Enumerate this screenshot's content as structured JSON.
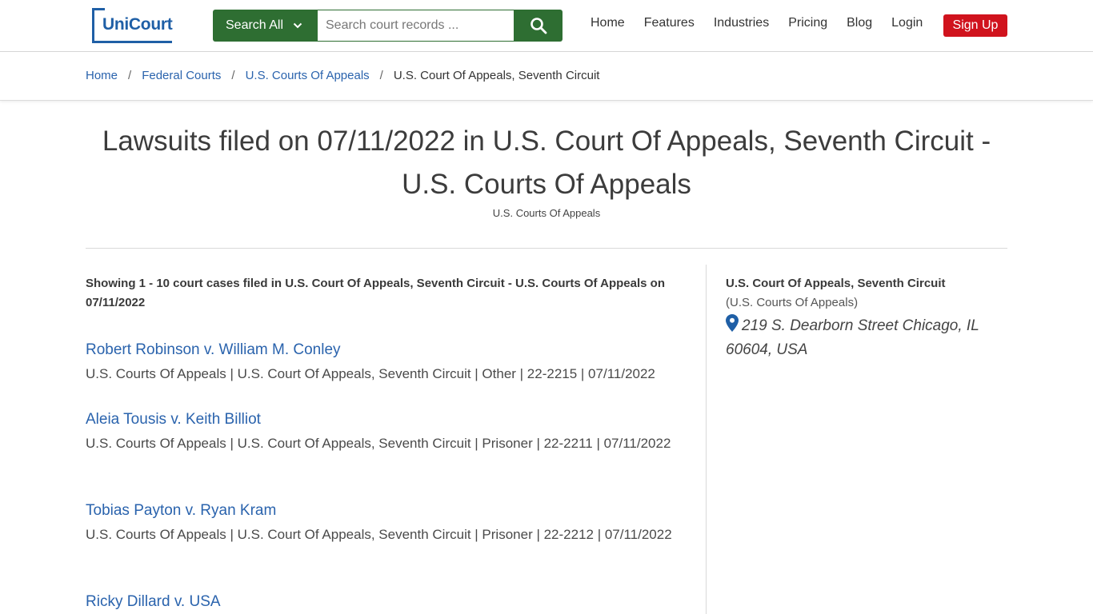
{
  "brand": {
    "logo_text": "UniCourt",
    "color": "#1f5fa6"
  },
  "search": {
    "scope_label": "Search All",
    "placeholder": "Search court records ...",
    "button_color": "#2e6e32"
  },
  "nav": {
    "items": [
      "Home",
      "Features",
      "Industries",
      "Pricing",
      "Blog",
      "Login"
    ],
    "signup_label": "Sign Up",
    "signup_color": "#d0131d"
  },
  "breadcrumb": {
    "items": [
      "Home",
      "Federal Courts",
      "U.S. Courts Of Appeals"
    ],
    "current": "U.S. Court Of Appeals, Seventh Circuit",
    "separator": "/"
  },
  "page": {
    "title": "Lawsuits filed on 07/11/2022 in U.S. Court Of Appeals, Seventh Circuit - U.S. Courts Of Appeals",
    "subtitle": "U.S. Courts Of Appeals",
    "showing": "Showing 1 - 10 court cases filed in U.S. Court Of Appeals, Seventh Circuit - U.S. Courts Of Appeals on 07/11/2022"
  },
  "cases": [
    {
      "title": "Robert Robinson v. William M. Conley",
      "meta": "U.S. Courts Of Appeals | U.S. Court Of Appeals, Seventh Circuit | Other | 22-2215 | 07/11/2022"
    },
    {
      "title": "Aleia Tousis v. Keith Billiot",
      "meta": "U.S. Courts Of Appeals | U.S. Court Of Appeals, Seventh Circuit | Prisoner | 22-2211 | 07/11/2022"
    },
    {
      "title": "Tobias Payton v. Ryan Kram",
      "meta": "U.S. Courts Of Appeals | U.S. Court Of Appeals, Seventh Circuit | Prisoner | 22-2212 | 07/11/2022"
    },
    {
      "title": "Ricky Dillard v. USA",
      "meta": ""
    }
  ],
  "sidebar": {
    "court_name": "U.S. Court Of Appeals, Seventh Circuit",
    "court_system": "(U.S. Courts Of Appeals)",
    "address": "219 S. Dearborn Street Chicago, IL 60604, USA",
    "pin_color": "#1f5fa6"
  }
}
